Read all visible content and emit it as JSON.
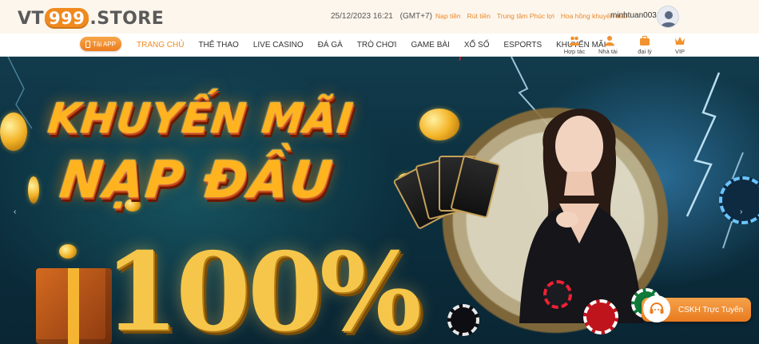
{
  "header": {
    "logo": {
      "prefix": "VT",
      "badge": "999",
      "suffix": ".STORE"
    },
    "datetime": "25/12/2023 16:21",
    "timezone": "(GMT+7)",
    "links": [
      "Nạp tiền",
      "Rút tiền",
      "Trung tâm Phúc lợi",
      "Hoa hồng khuyến mãi"
    ],
    "username": "minhtuan003"
  },
  "nav": {
    "app_button": "Tải APP",
    "items": [
      "TRANG CHỦ",
      "THỂ THAO",
      "LIVE CASINO",
      "ĐÁ GÀ",
      "TRÒ CHƠI",
      "GAME BÀI",
      "XỔ SỐ",
      "ESPORTS",
      "KHUYẾN MÃI"
    ],
    "active_index": 0,
    "icon_links": [
      {
        "label": "Hợp tác",
        "icon": "partners-icon"
      },
      {
        "label": "Nhà tài trợ",
        "icon": "sponsor-icon"
      },
      {
        "label": "đại lý",
        "icon": "agent-icon"
      },
      {
        "label": "VIP",
        "icon": "crown-icon"
      }
    ]
  },
  "banner": {
    "title_line1": "KHUYẾN MÃI",
    "title_line2": "NẠP ĐẦU",
    "percent": "100%"
  },
  "support": {
    "label": "CSKH Trực Tuyến"
  },
  "slider": {
    "prev": "‹",
    "next": "›"
  },
  "colors": {
    "accent": "#ef8a22",
    "topbar_bg": "#fdf6ec",
    "banner_bg": "#0c3140"
  }
}
